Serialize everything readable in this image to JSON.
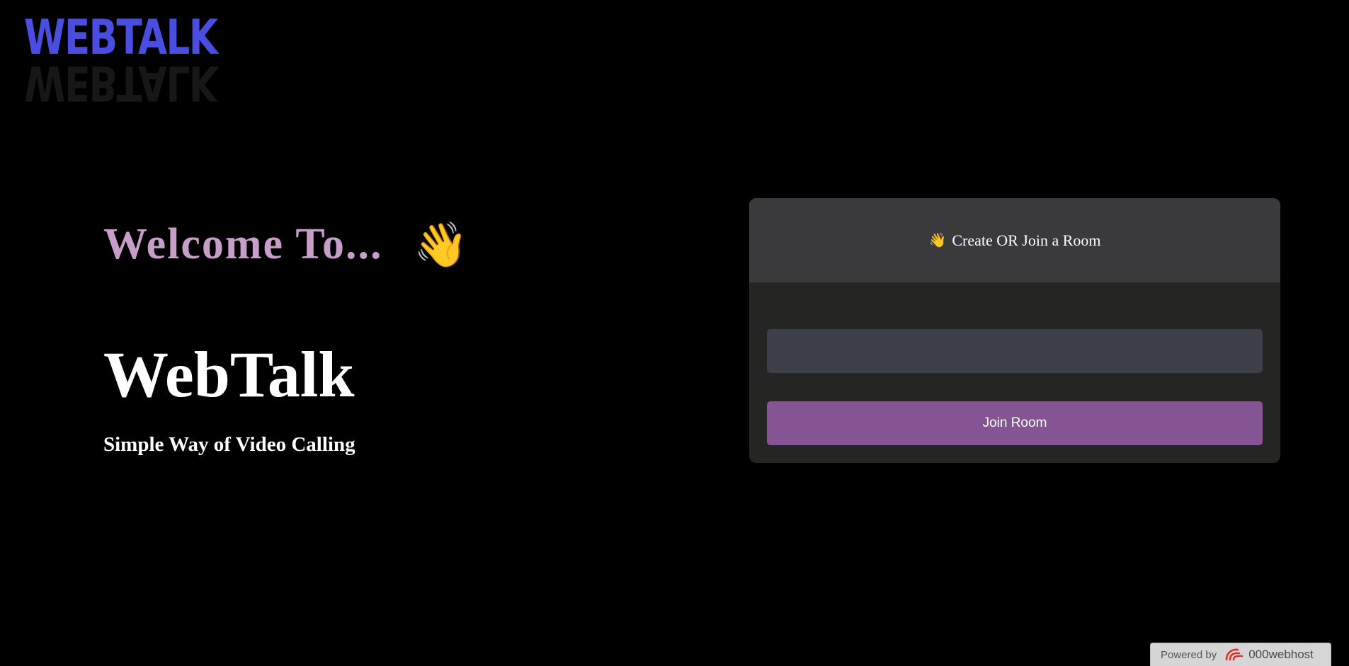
{
  "logo": {
    "text": "WEBTALK"
  },
  "hero": {
    "welcome": "Welcome To...",
    "brand": "WebTalk",
    "tagline": "Simple Way of Video Calling"
  },
  "room_card": {
    "header_icon": "👋",
    "header_title": "Create OR Join a Room",
    "input_value": "",
    "input_placeholder": "",
    "join_label": "Join Room"
  },
  "footer_badge": {
    "powered_label": "Powered by",
    "host_name": "000webhost"
  },
  "colors": {
    "background": "#000000",
    "logo": "#4a4ee0",
    "welcome": "#c79ec8",
    "card_header": "#3a3a3c",
    "card_body": "#252523",
    "input_bg": "#3d4049",
    "button_bg": "#845592"
  },
  "icons": {
    "wave": "waving-hand-icon",
    "host": "000webhost-logo-icon"
  }
}
